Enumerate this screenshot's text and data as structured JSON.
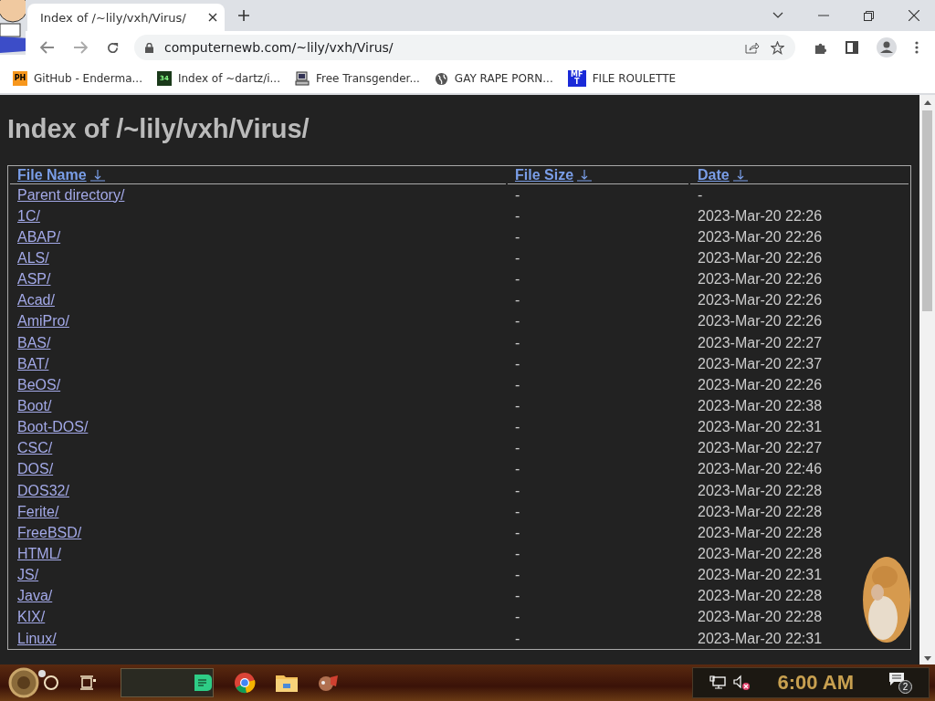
{
  "tab": {
    "title": "Index of /~lily/vxh/Virus/",
    "selected": true
  },
  "address": {
    "url": "computernewb.com/~lily/vxh/Virus/"
  },
  "bookmarks": [
    {
      "kind": "ph",
      "icon_text": "PH",
      "label": "GitHub - Enderma..."
    },
    {
      "kind": "grid",
      "icon_text": "34",
      "label": "Index of ~dartz/i..."
    },
    {
      "kind": "computer",
      "label": "Free Transgender..."
    },
    {
      "kind": "globe",
      "label": "GAY RAPE PORN..."
    },
    {
      "kind": "mft",
      "icon_text": "MF T",
      "label": "FILE ROULETTE"
    }
  ],
  "page": {
    "heading": "Index of /~lily/vxh/Virus/",
    "columns": [
      "File Name",
      "File Size",
      "Date"
    ],
    "rows": [
      {
        "name": "Parent directory/",
        "size": "-",
        "date": "-"
      },
      {
        "name": "1C/",
        "size": "-",
        "date": "2023-Mar-20 22:26"
      },
      {
        "name": "ABAP/",
        "size": "-",
        "date": "2023-Mar-20 22:26"
      },
      {
        "name": "ALS/",
        "size": "-",
        "date": "2023-Mar-20 22:26"
      },
      {
        "name": "ASP/",
        "size": "-",
        "date": "2023-Mar-20 22:26"
      },
      {
        "name": "Acad/",
        "size": "-",
        "date": "2023-Mar-20 22:26"
      },
      {
        "name": "AmiPro/",
        "size": "-",
        "date": "2023-Mar-20 22:26"
      },
      {
        "name": "BAS/",
        "size": "-",
        "date": "2023-Mar-20 22:27"
      },
      {
        "name": "BAT/",
        "size": "-",
        "date": "2023-Mar-20 22:37"
      },
      {
        "name": "BeOS/",
        "size": "-",
        "date": "2023-Mar-20 22:26"
      },
      {
        "name": "Boot/",
        "size": "-",
        "date": "2023-Mar-20 22:38"
      },
      {
        "name": "Boot-DOS/",
        "size": "-",
        "date": "2023-Mar-20 22:31"
      },
      {
        "name": "CSC/",
        "size": "-",
        "date": "2023-Mar-20 22:27"
      },
      {
        "name": "DOS/",
        "size": "-",
        "date": "2023-Mar-20 22:46"
      },
      {
        "name": "DOS32/",
        "size": "-",
        "date": "2023-Mar-20 22:28"
      },
      {
        "name": "Ferite/",
        "size": "-",
        "date": "2023-Mar-20 22:28"
      },
      {
        "name": "FreeBSD/",
        "size": "-",
        "date": "2023-Mar-20 22:28"
      },
      {
        "name": "HTML/",
        "size": "-",
        "date": "2023-Mar-20 22:28"
      },
      {
        "name": "JS/",
        "size": "-",
        "date": "2023-Mar-20 22:31"
      },
      {
        "name": "Java/",
        "size": "-",
        "date": "2023-Mar-20 22:28"
      },
      {
        "name": "KIX/",
        "size": "-",
        "date": "2023-Mar-20 22:28"
      },
      {
        "name": "Linux/",
        "size": "-",
        "date": "2023-Mar-20 22:31"
      }
    ]
  },
  "taskbar": {
    "clock": "6:00 AM",
    "speaker_muted": true,
    "notification_count": "2"
  }
}
